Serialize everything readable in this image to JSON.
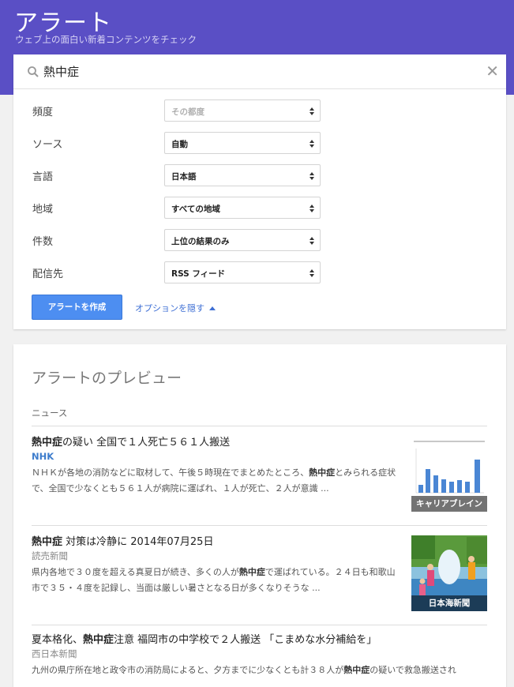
{
  "header": {
    "title": "アラート",
    "subtitle": "ウェブ上の面白い新着コンテンツをチェック"
  },
  "search": {
    "query": "熱中症",
    "icon": "search-icon",
    "clear_icon": "close-icon",
    "clear_glyph": "✕"
  },
  "options": {
    "frequency": {
      "label": "頻度",
      "value": "その都度"
    },
    "sources": {
      "label": "ソース",
      "value": "自動"
    },
    "language": {
      "label": "言語",
      "value": "日本語"
    },
    "region": {
      "label": "地域",
      "value": "すべての地域"
    },
    "count": {
      "label": "件数",
      "value": "上位の結果のみ"
    },
    "deliver": {
      "label": "配信先",
      "value": "RSS フィード"
    }
  },
  "actions": {
    "create_label": "アラートを作成",
    "hide_options_label": "オプションを隠す"
  },
  "preview": {
    "title": "アラートのプレビュー",
    "section": "ニュース",
    "items": [
      {
        "headline_bold": "熱中症",
        "headline_rest": "の疑い 全国で１人死亡５６１人搬送",
        "source": "NHK",
        "snippet_a": "ＮＨＫが各地の消防などに取材して、午後５時現在でまとめたところ、",
        "snippet_bold": "熱中症",
        "snippet_b": "とみられる症状で、全国で少なくとも５６１人が病院に運ばれ、１人が死亡、２人が意識 ...",
        "thumb_caption": "キャリアブレイン"
      },
      {
        "headline_bold": "熱中症",
        "headline_rest": " 対策は冷静に 2014年07月25日",
        "source": "読売新聞",
        "snippet_a": "県内各地で３０度を超える真夏日が続き、多くの人が",
        "snippet_bold": "熱中症",
        "snippet_b": "で運ばれている。２４日も和歌山市で３５・４度を記録し、当面は厳しい暑さとなる日が多くなりそうな ...",
        "thumb_caption": "日本海新聞"
      },
      {
        "headline_pre": "夏本格化、",
        "headline_bold": "熱中症",
        "headline_rest": "注意 福岡市の中学校で２人搬送 「こまめな水分補給を」",
        "source": "西日本新聞",
        "snippet_a": "九州の県庁所在地と政令市の消防局によると、夕方までに少なくとも計３８人が",
        "snippet_bold": "熱中症",
        "snippet_b": "の疑いで救急搬送され"
      }
    ]
  },
  "colors": {
    "header_bg": "#5a4fc5",
    "primary_button": "#4d8ef1",
    "link": "#3e6fd4",
    "nhk_source": "#3d7ccc"
  }
}
